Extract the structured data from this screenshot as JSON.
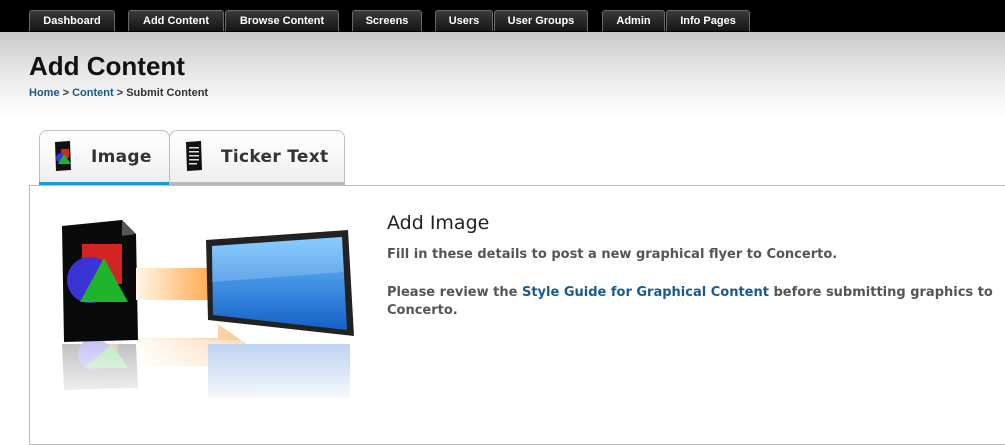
{
  "nav": {
    "items": [
      "Dashboard",
      "Add Content",
      "Browse Content",
      "Screens",
      "Users",
      "User Groups",
      "Admin",
      "Info Pages"
    ]
  },
  "header": {
    "title": "Add Content",
    "breadcrumb": {
      "home": "Home",
      "sep1": " > ",
      "content": "Content",
      "sep2": " > ",
      "current": "Submit Content"
    }
  },
  "tabs": [
    {
      "label": "Image",
      "icon": "image-icon",
      "active": true
    },
    {
      "label": "Ticker Text",
      "icon": "ticker-text-icon",
      "active": false
    }
  ],
  "main": {
    "title": "Add Image",
    "description": "Fill in these details to post a new graphical flyer to Concerto.",
    "review_prefix": "Please review the ",
    "review_link": "Style Guide for Graphical Content",
    "review_suffix": " before submitting graphics to Concerto."
  },
  "colors": {
    "active_tab_bar": "#1a9ad6",
    "inactive_tab_bar": "#b8b8b8",
    "link": "#1a5a8a",
    "nav_bg": "#000000"
  }
}
